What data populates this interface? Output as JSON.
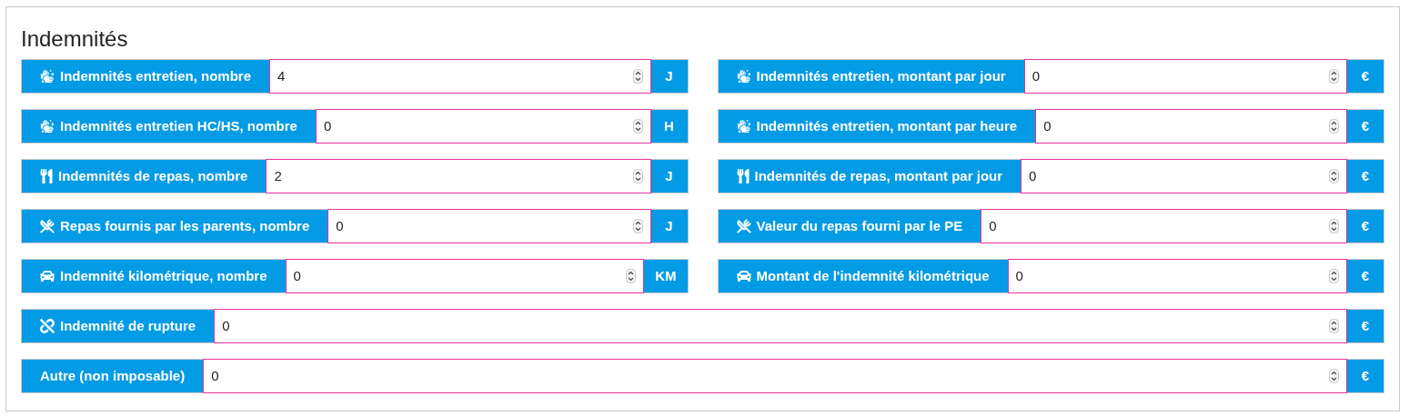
{
  "title": "Indemnités",
  "rows": [
    {
      "fields": [
        {
          "kind": "hands",
          "label": "Indemnités entretien, nombre",
          "value": "4",
          "unit": "J"
        },
        {
          "kind": "hands",
          "label": "Indemnités entretien, montant par jour",
          "value": "0",
          "unit": "€"
        }
      ]
    },
    {
      "fields": [
        {
          "kind": "hands",
          "label": "Indemnités entretien HC/HS, nombre",
          "value": "0",
          "unit": "H"
        },
        {
          "kind": "hands",
          "label": "Indemnités entretien, montant par heure",
          "value": "0",
          "unit": "€"
        }
      ]
    },
    {
      "fields": [
        {
          "kind": "utensils",
          "label": "Indemnités de repas, nombre",
          "value": "2",
          "unit": "J"
        },
        {
          "kind": "utensils",
          "label": "Indemnités de repas, montant par jour",
          "value": "0",
          "unit": "€"
        }
      ]
    },
    {
      "fields": [
        {
          "kind": "crossed",
          "label": "Repas fournis par les parents, nombre",
          "value": "0",
          "unit": "J"
        },
        {
          "kind": "crossed",
          "label": "Valeur du repas fourni par le PE",
          "value": "0",
          "unit": "€"
        }
      ]
    },
    {
      "fields": [
        {
          "kind": "car",
          "label": "Indemnité kilométrique, nombre",
          "value": "0",
          "unit": "KM"
        },
        {
          "kind": "car",
          "label": "Montant de l'indemnité kilométrique",
          "value": "0",
          "unit": "€"
        }
      ]
    },
    {
      "fields": [
        {
          "kind": "rupture",
          "label": "Indemnité de rupture",
          "value": "0",
          "unit": "€"
        }
      ]
    },
    {
      "fields": [
        {
          "label": "Autre (non imposable)",
          "value": "0",
          "unit": "€"
        }
      ]
    }
  ]
}
